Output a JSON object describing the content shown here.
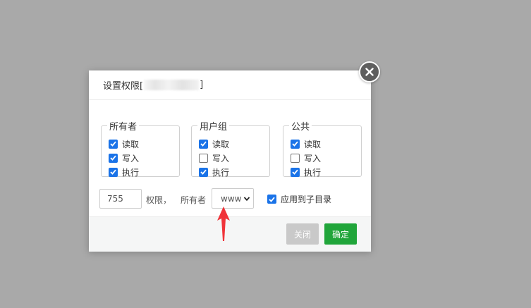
{
  "dialog": {
    "title_prefix": "设置权限[",
    "title_suffix": "]"
  },
  "groups": [
    {
      "legend": "所有者",
      "read": {
        "label": "读取",
        "checked": true
      },
      "write": {
        "label": "写入",
        "checked": true
      },
      "exec": {
        "label": "执行",
        "checked": true
      }
    },
    {
      "legend": "用户组",
      "read": {
        "label": "读取",
        "checked": true
      },
      "write": {
        "label": "写入",
        "checked": false
      },
      "exec": {
        "label": "执行",
        "checked": true
      }
    },
    {
      "legend": "公共",
      "read": {
        "label": "读取",
        "checked": true
      },
      "write": {
        "label": "写入",
        "checked": false
      },
      "exec": {
        "label": "执行",
        "checked": true
      }
    }
  ],
  "mode": {
    "value": "755",
    "label": "权限，"
  },
  "owner": {
    "label": "所有者",
    "value": "www"
  },
  "apply_subdirs": {
    "label": "应用到子目录",
    "checked": true
  },
  "buttons": {
    "close": "关闭",
    "confirm": "确定"
  },
  "colors": {
    "accent": "#1a73e8",
    "confirm": "#20a53a",
    "annotation_arrow": "#f0343a"
  }
}
